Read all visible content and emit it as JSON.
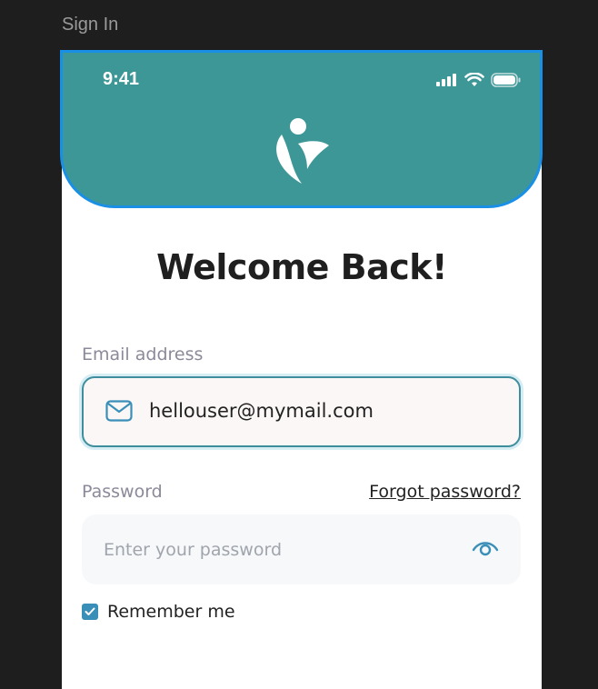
{
  "frame": {
    "label": "Sign In"
  },
  "status_bar": {
    "time": "9:41",
    "icons": [
      "signal-icon",
      "wifi-icon",
      "battery-icon"
    ]
  },
  "header": {
    "logo": "app-logo"
  },
  "form": {
    "title": "Welcome Back!",
    "email": {
      "label": "Email address",
      "value": "hellouser@mymail.com"
    },
    "password": {
      "label": "Password",
      "placeholder": "Enter your password"
    },
    "forgot_password": "Forgot password?",
    "remember_me": {
      "label": "Remember me",
      "checked": true
    }
  },
  "colors": {
    "header": "#3e9797",
    "accent": "#3a8fb8",
    "selection": "#1a8fe6",
    "background": "#1e1e1e"
  }
}
